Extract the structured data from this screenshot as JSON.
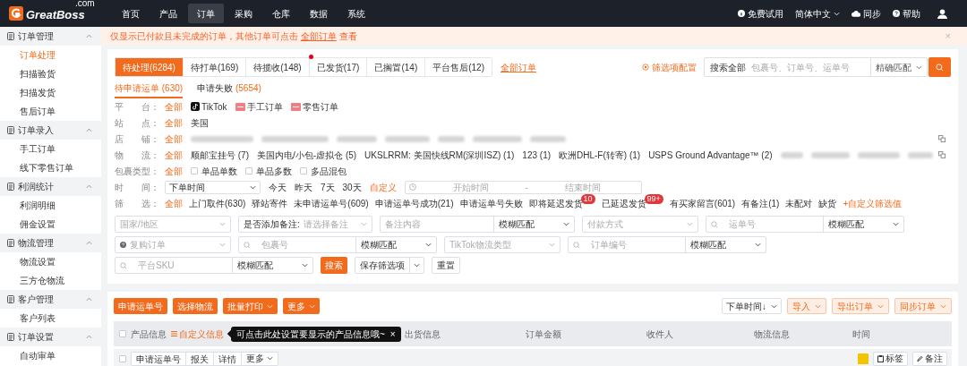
{
  "nav": {
    "logo": "GreatBoss",
    "logo_sup": ".com",
    "items": [
      {
        "label": "首页",
        "selected": false
      },
      {
        "label": "产品",
        "selected": false
      },
      {
        "label": "订单",
        "selected": true
      },
      {
        "label": "采购",
        "selected": false
      },
      {
        "label": "仓库",
        "selected": false
      },
      {
        "label": "数据",
        "selected": false
      },
      {
        "label": "系统",
        "selected": false
      }
    ],
    "right": [
      {
        "label": "免费试用",
        "kind": "trial"
      },
      {
        "label": "简体中文",
        "kind": "lang"
      },
      {
        "label": "同步",
        "kind": "sync"
      },
      {
        "label": "帮助",
        "kind": "help"
      }
    ]
  },
  "sidebar": [
    {
      "title": "订单管理",
      "expanded": true,
      "items": [
        {
          "label": "订单处理",
          "selected": true
        },
        {
          "label": "扫描验货",
          "selected": false
        },
        {
          "label": "扫描发货",
          "selected": false
        },
        {
          "label": "售后订单",
          "selected": false
        }
      ]
    },
    {
      "title": "订单录入",
      "expanded": true,
      "items": [
        {
          "label": "手工订单",
          "selected": false
        },
        {
          "label": "线下零售订单",
          "selected": false
        }
      ]
    },
    {
      "title": "利润统计",
      "expanded": true,
      "items": [
        {
          "label": "利润明细",
          "selected": false
        },
        {
          "label": "佣金设置",
          "selected": false
        }
      ]
    },
    {
      "title": "物流管理",
      "expanded": true,
      "items": [
        {
          "label": "物流设置",
          "selected": false
        },
        {
          "label": "三方仓物流",
          "selected": false
        }
      ]
    },
    {
      "title": "客户管理",
      "expanded": true,
      "items": [
        {
          "label": "客户列表",
          "selected": false
        }
      ]
    },
    {
      "title": "订单设置",
      "expanded": true,
      "items": [
        {
          "label": "自动审单",
          "selected": false
        }
      ]
    }
  ],
  "notice": {
    "text": "仅显示已付款且未完成的订单，其他订单可点击",
    "link": "全部订单",
    "suffix": "查看",
    "close": "×"
  },
  "status_tabs": [
    {
      "label": "待处理(6284)",
      "selected": true,
      "alert": false
    },
    {
      "label": "待打单(169)",
      "selected": false,
      "alert": false
    },
    {
      "label": "待揽收(148)",
      "selected": false,
      "alert": false
    },
    {
      "label": "已发货(17)",
      "selected": false,
      "alert": true
    },
    {
      "label": "已搁置(14)",
      "selected": false,
      "alert": false
    },
    {
      "label": "平台售后(12)",
      "selected": false,
      "alert": false
    }
  ],
  "all_orders_link": "全部订单",
  "filter_config": "筛选项配置",
  "search": {
    "scope": "搜索全部",
    "placeholder": "包裹号、订单号、运单号",
    "match": "精确匹配"
  },
  "sub_tabs": [
    {
      "label": "待申请运单",
      "count": "(630)",
      "selected": true
    },
    {
      "label": "申请失败",
      "count": "(5654)",
      "selected": false
    }
  ],
  "filter_rows": [
    {
      "label": "平　　台：",
      "copy": false,
      "options": [
        {
          "label": "全部",
          "selected": true
        },
        {
          "label": "TikTok",
          "kind": "tiktok",
          "selected": false
        },
        {
          "label": "手工订单",
          "kind": "tag",
          "selected": false
        },
        {
          "label": "零售订单",
          "kind": "tag",
          "selected": false
        }
      ]
    },
    {
      "label": "站　　点：",
      "copy": false,
      "options": [
        {
          "label": "全部",
          "selected": true
        },
        {
          "label": "美国",
          "selected": false
        }
      ]
    },
    {
      "label": "店　　铺：",
      "copy": true,
      "options": [
        {
          "label": "全部",
          "selected": true
        },
        {
          "kind": "blurred"
        },
        {
          "kind": "blurred"
        },
        {
          "kind": "blurred"
        },
        {
          "kind": "blurred"
        },
        {
          "kind": "blurred"
        },
        {
          "kind": "blurred"
        },
        {
          "kind": "blurred"
        }
      ]
    },
    {
      "label": "物　　流：",
      "copy": true,
      "options": [
        {
          "label": "全部",
          "selected": true
        },
        {
          "label": "顺邮宝挂号 (7)",
          "selected": false
        },
        {
          "label": "美国内电/小包-虚拟仓 (5)",
          "selected": false
        },
        {
          "label": "UKSLRRM: 美国快线RM(深圳ISZ) (1)",
          "selected": false
        },
        {
          "label": "123 (1)",
          "selected": false
        },
        {
          "label": "欧洲DHL-F(转寄) (1)",
          "selected": false
        },
        {
          "label": "USPS Ground Advantage™ (2)",
          "selected": false
        },
        {
          "kind": "blurred"
        },
        {
          "kind": "blurred"
        },
        {
          "kind": "blurred"
        },
        {
          "kind": "blurred"
        }
      ]
    },
    {
      "label": "包裹类型：",
      "copy": false,
      "options": [
        {
          "label": "全部",
          "selected": true
        },
        {
          "label": "单品单数",
          "kind": "checkbox",
          "checked": false
        },
        {
          "label": "单品多数",
          "kind": "checkbox",
          "checked": false
        },
        {
          "label": "多品混包",
          "kind": "checkbox",
          "checked": false
        }
      ]
    }
  ],
  "time_row": {
    "label": "时　　间：",
    "select": "下单时间",
    "quick": [
      {
        "label": "今天",
        "selected": false
      },
      {
        "label": "昨天",
        "selected": false
      },
      {
        "label": "7天",
        "selected": false
      },
      {
        "label": "30天",
        "selected": false
      },
      {
        "label": "自定义",
        "selected": true
      }
    ],
    "start": "开始时间",
    "separator": "-",
    "end": "结束时间"
  },
  "quick_filters": {
    "label": "筛　　选：",
    "options": [
      {
        "label": "全部",
        "selected": true
      },
      {
        "label": "上门取件(630)",
        "selected": false
      },
      {
        "label": "驿站寄件",
        "selected": false
      },
      {
        "label": "未申请运单号(609)",
        "selected": false
      },
      {
        "label": "申请运单号成功(21)",
        "selected": false
      },
      {
        "label": "申请运单号失败",
        "selected": false
      },
      {
        "label": "即将延迟发货",
        "badge": "10",
        "selected": false
      },
      {
        "label": "已延迟发货",
        "badge": "99+",
        "selected": false
      },
      {
        "label": "有买家留言(601)",
        "selected": false
      },
      {
        "label": "有备注(1)",
        "selected": false
      },
      {
        "label": "未配对",
        "selected": false
      },
      {
        "label": "缺货",
        "selected": false
      }
    ],
    "custom": "+自定义筛选值"
  },
  "field_rows": [
    [
      {
        "kind": "select",
        "placeholder": "国家/地区"
      },
      {
        "kind": "labeled",
        "label": "是否添加备注:",
        "placeholder": "请选择备注"
      },
      {
        "kind": "input",
        "placeholder": "备注内容",
        "match": "模糊匹配"
      },
      {
        "kind": "select",
        "placeholder": "付款方式"
      },
      {
        "kind": "search",
        "placeholder": "运单号",
        "match": "模糊匹配"
      }
    ],
    [
      {
        "kind": "help-select",
        "placeholder": "复购订单"
      },
      {
        "kind": "search",
        "placeholder": "包裹号",
        "match": "模糊匹配"
      },
      {
        "kind": "select",
        "placeholder": "TikTok物流类型"
      },
      {
        "kind": "search",
        "placeholder": "订单编号",
        "match": "模糊匹配"
      }
    ],
    [
      {
        "kind": "search",
        "placeholder": "平台SKU",
        "match": "模糊匹配"
      },
      {
        "kind": "primary",
        "label": "搜索"
      },
      {
        "kind": "split",
        "label": "保存筛选项"
      },
      {
        "kind": "plain",
        "label": "重置"
      }
    ]
  ],
  "toolbar": {
    "left": [
      {
        "label": "申请运单号",
        "menu": false
      },
      {
        "label": "选择物流",
        "menu": false
      },
      {
        "label": "批量打印",
        "menu": true
      },
      {
        "label": "更多",
        "menu": true
      }
    ],
    "sort": "下单时间↓",
    "right": [
      "导入",
      "导出订单",
      "同步订单"
    ]
  },
  "table": {
    "header_checked": false,
    "columns": [
      "产品信息",
      "出货信息",
      "订单金额",
      "收件人",
      "物流信息",
      "时间"
    ],
    "customize": "自定义信息",
    "tooltip": "可点击此处设置要显示的产品信息哦~",
    "tooltip_close": "×",
    "row": {
      "checked": false,
      "actions": [
        "申请运单号",
        "报关",
        "详情"
      ],
      "more": "更多",
      "color": "#f5c400",
      "buttons": [
        "标签",
        "备注"
      ]
    }
  }
}
